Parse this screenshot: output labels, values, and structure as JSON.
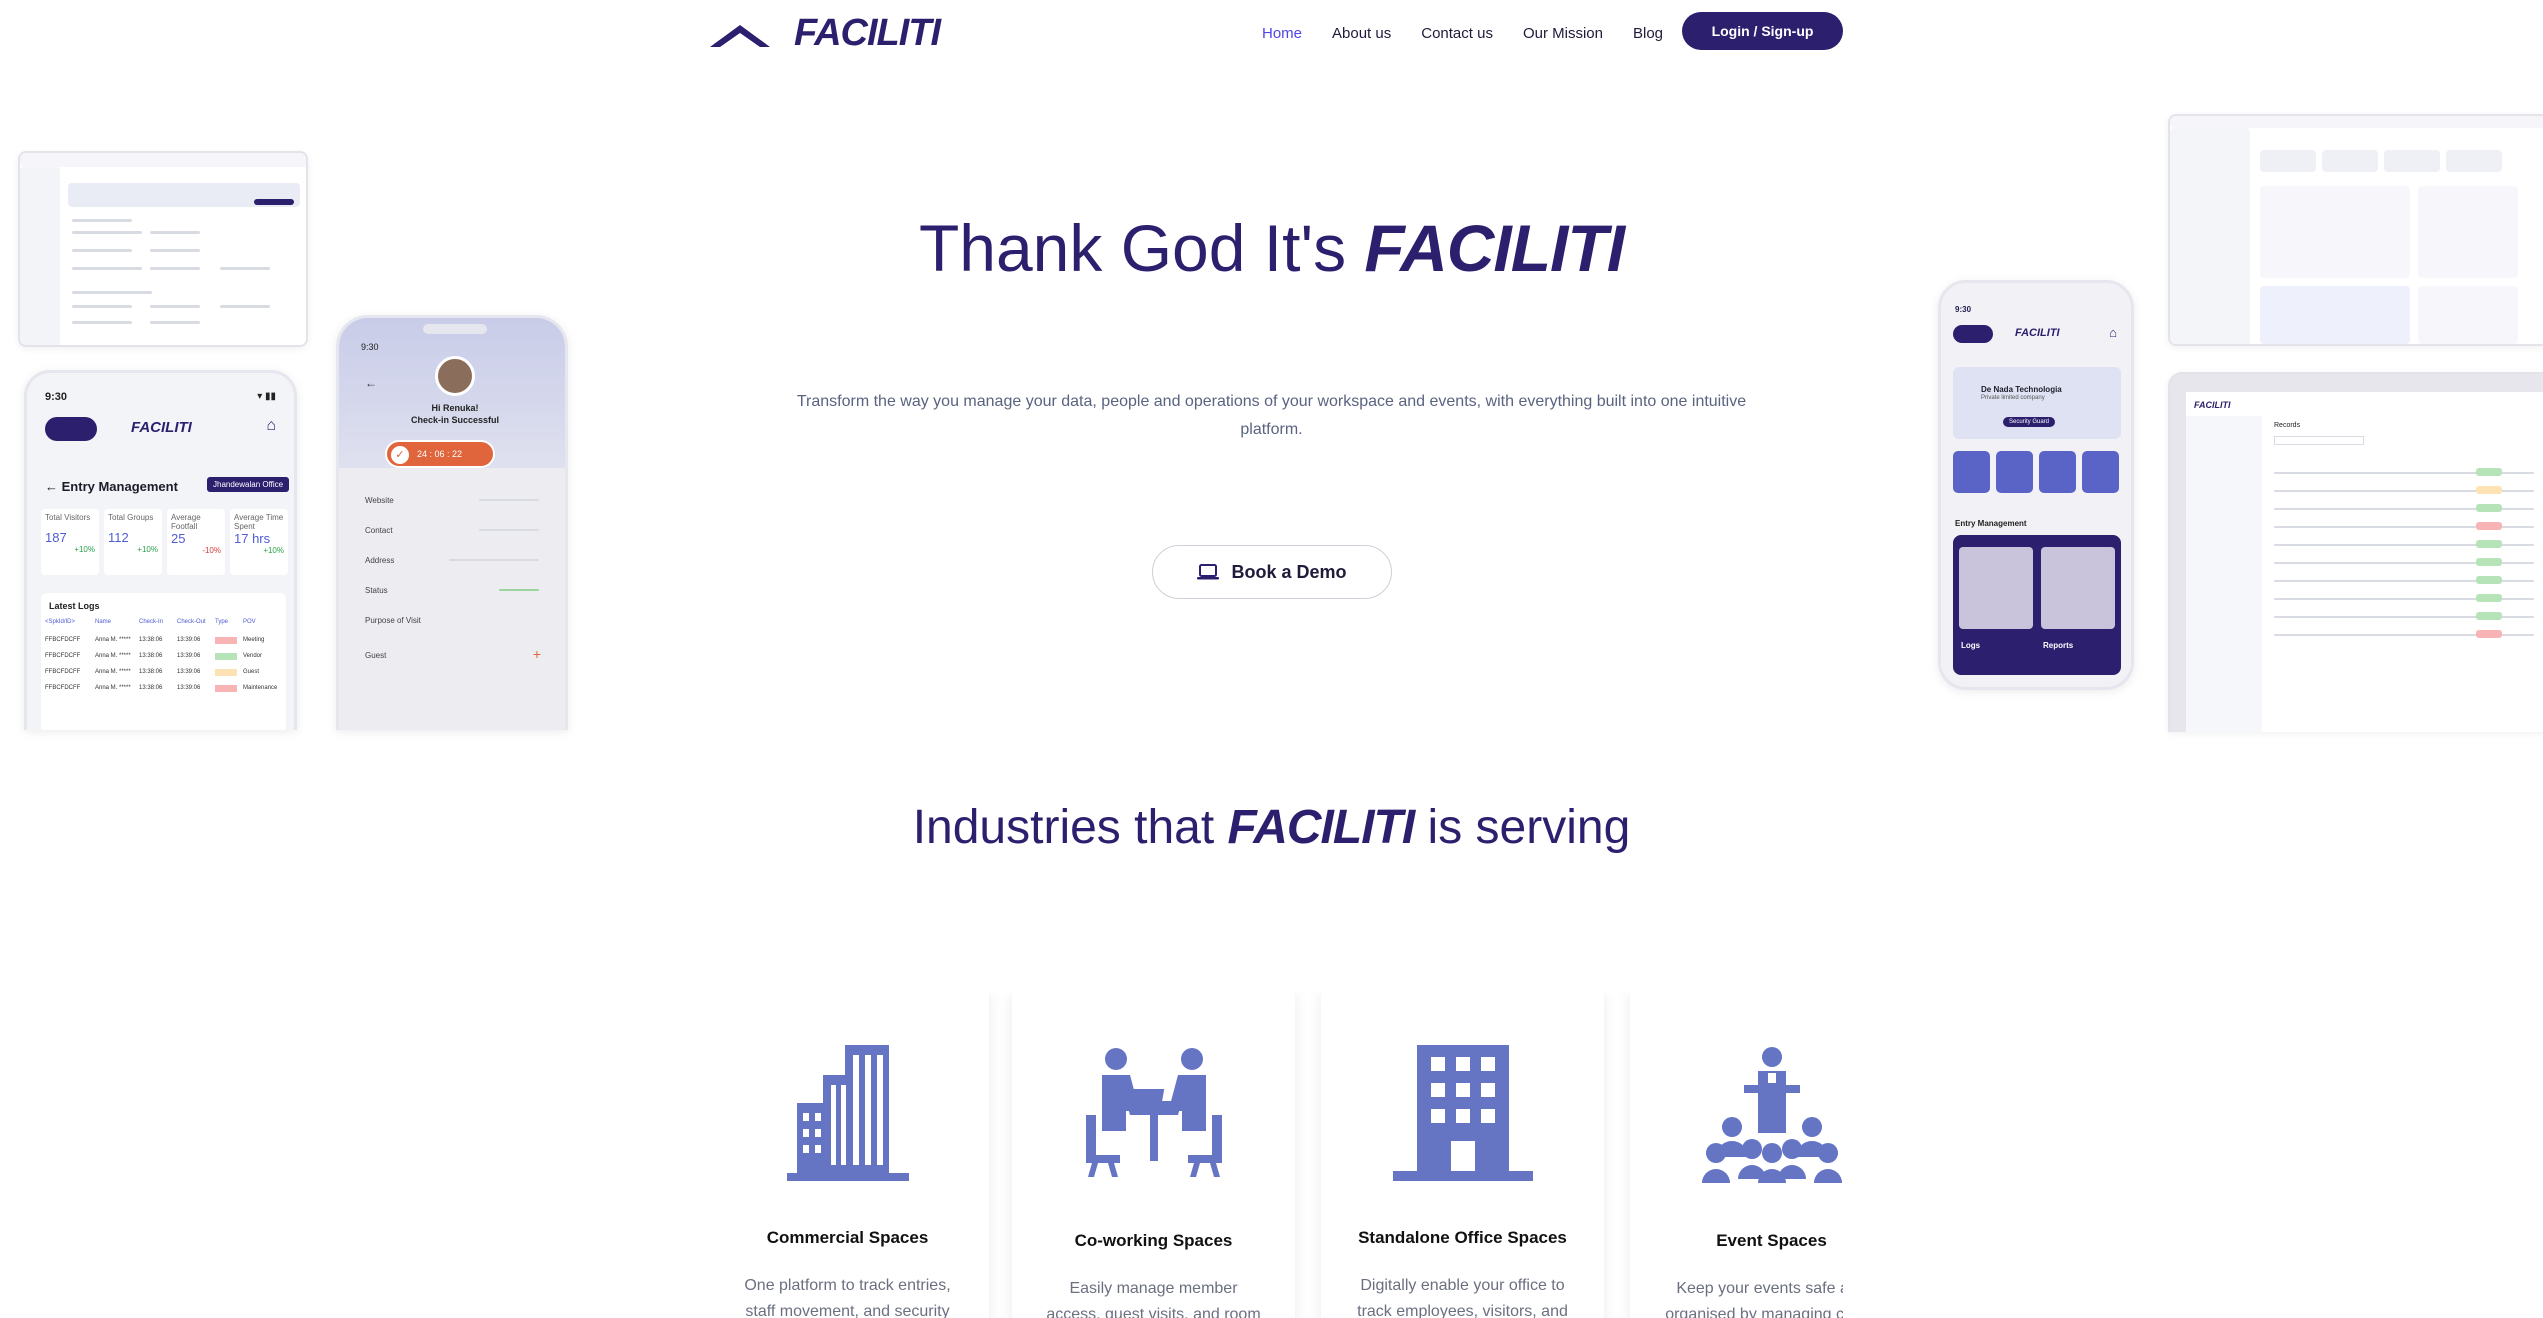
{
  "nav": {
    "brand": "FACILITI",
    "links": [
      "Home",
      "About us",
      "Contact us",
      "Our Mission",
      "Blog"
    ],
    "active": "Home",
    "login_label": "Login / Sign-up"
  },
  "hero": {
    "title_prefix": "Thank God It's ",
    "title_brand": "FACILITI",
    "subtitle": "Transform the way you manage your data, people and operations of your workspace and events, with everything built into one intuitive platform.",
    "demo_label": "Book a Demo"
  },
  "mockups": {
    "left_phone": {
      "time": "9:30",
      "brand": "FACILITI",
      "title": "Entry Management",
      "office": "Jhandewalan Office",
      "stats": [
        {
          "label": "Total Visitors",
          "value": "187",
          "change": "+10%"
        },
        {
          "label": "Total Groups",
          "value": "112",
          "change": "+10%"
        },
        {
          "label": "Average Footfall",
          "value": "25",
          "change": "-10%"
        },
        {
          "label": "Average Time Spent",
          "value": "17 hrs",
          "change": "+10%"
        }
      ],
      "logs_title": "Latest Logs",
      "log_headers": [
        "<SpkId/ID>",
        "Name",
        "Check-In",
        "Check-Out",
        "Type",
        "POV"
      ],
      "log_rows": [
        [
          "FFBCFDCFF",
          "Anna M. *****",
          "13:38:06",
          "13:39:06",
          "Meeting"
        ],
        [
          "FFBCFDCFF",
          "Anna M. *****",
          "13:38:06",
          "13:39:06",
          "Vendor"
        ],
        [
          "FFBCFDCFF",
          "Anna M. *****",
          "13:38:06",
          "13:39:06",
          "Guest"
        ],
        [
          "FFBCFDCFF",
          "Anna M. *****",
          "13:38:06",
          "13:39:06",
          "Maintenance"
        ]
      ]
    },
    "checkin_phone": {
      "time": "9:30",
      "greeting": "Hi Renuka!",
      "status": "Check-in Successful",
      "timer": "24 : 06 : 22",
      "fields": [
        "Website",
        "Contact",
        "Address",
        "Status",
        "Purpose of Visit",
        "Guest"
      ]
    },
    "right_phone": {
      "time": "9:30",
      "brand": "FACILITI",
      "company": "De Nada Technologia",
      "company_sub": "Private limited company",
      "role": "Security Guard",
      "section": "Entry Management",
      "tiles": [
        "Logs",
        "Reports"
      ]
    },
    "right_desk": {
      "brand": "FACILITI",
      "page": "Records"
    }
  },
  "industries": {
    "title_prefix": "Industries that ",
    "title_brand": "FACILITI",
    "title_suffix": " is serving",
    "cards": [
      {
        "title": "Commercial Spaces",
        "desc": "One platform to track entries, staff movement, and security",
        "icon": "office-buildings-icon"
      },
      {
        "title": "Co-working Spaces",
        "desc": "Easily manage member access, guest visits, and room",
        "icon": "coworking-meeting-icon"
      },
      {
        "title": "Standalone Office Spaces",
        "desc": "Digitally enable your office to track employees, visitors, and",
        "icon": "office-tower-icon"
      },
      {
        "title": "Event Spaces",
        "desc": "Keep your events safe and organised by managing check",
        "icon": "event-audience-icon"
      }
    ]
  },
  "colors": {
    "brand": "#2b1f6e",
    "accent": "#4f46e5",
    "icon": "#6674c4"
  }
}
